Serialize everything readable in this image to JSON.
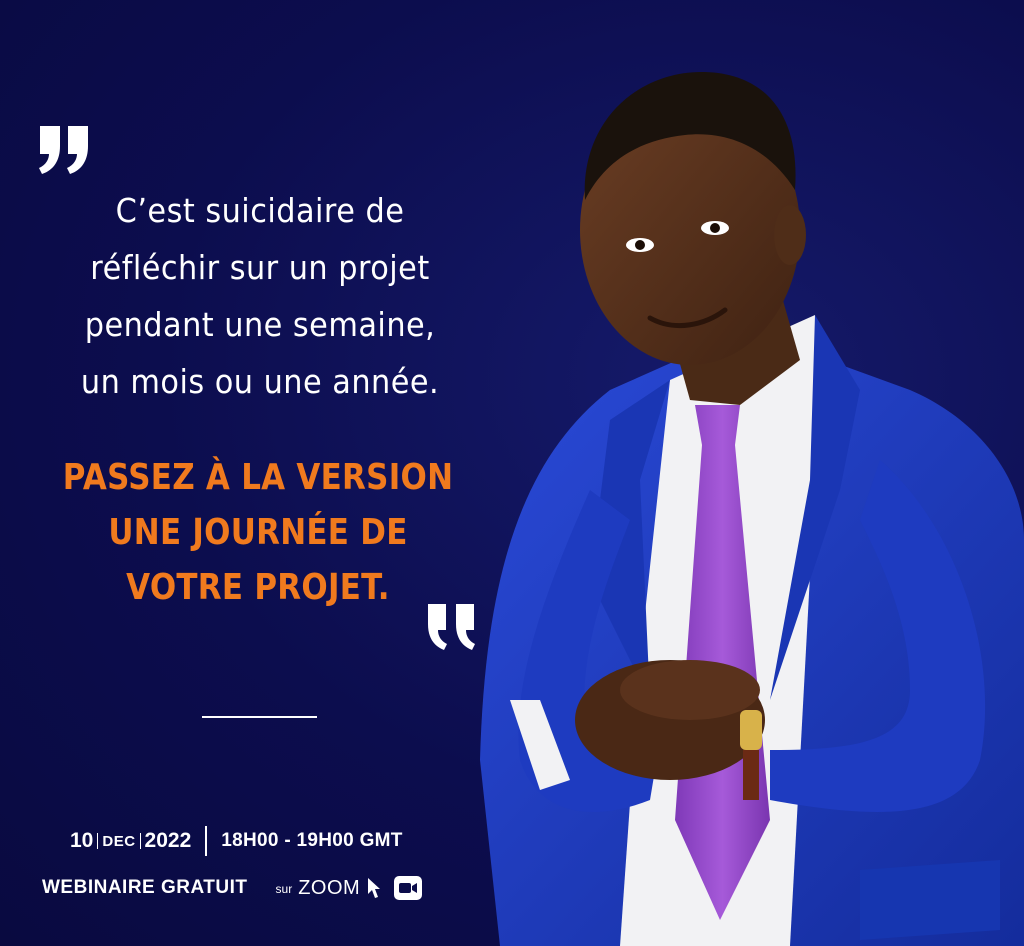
{
  "quote": {
    "lines": [
      "C’est suicidaire de",
      "réfléchir sur un projet",
      "pendant une semaine,",
      "un mois ou une année."
    ]
  },
  "cta": {
    "lines": [
      "PASSEZ À LA VERSION",
      "UNE JOURNÉE DE",
      "VOTRE PROJET."
    ]
  },
  "event": {
    "day": "10",
    "month": "DEC",
    "year": "2022",
    "time": "18H00 - 19H00 GMT",
    "title": "WEBINAIRE GRATUIT",
    "platform_prefix": "sur",
    "platform": "ZOOM"
  },
  "colors": {
    "background": "#0b0c4a",
    "accent": "#f07a1e",
    "text": "#ffffff",
    "suit": "#1f3bc4",
    "tie": "#9a4fd1"
  },
  "icons": {
    "open_quote": "open-quote-icon",
    "close_quote": "close-quote-icon",
    "cursor": "cursor-icon",
    "camera": "camera-icon"
  }
}
